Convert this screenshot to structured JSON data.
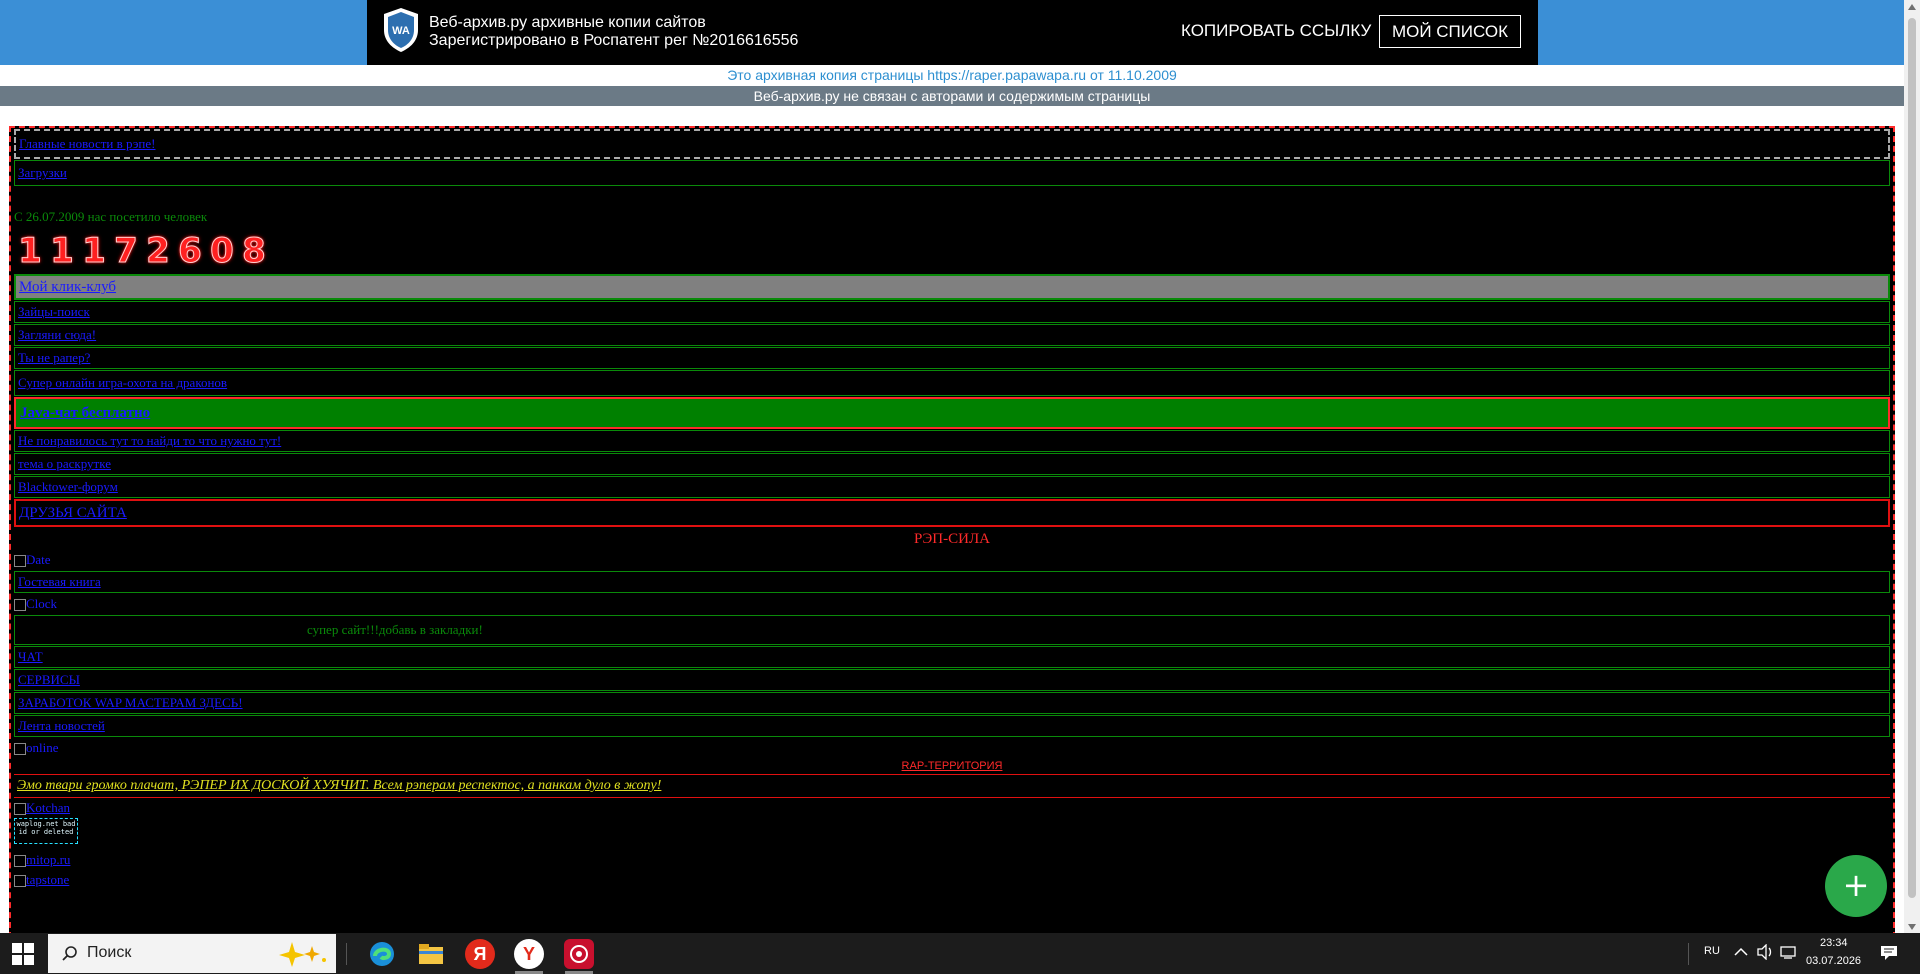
{
  "banner": {
    "brand_line1": "Веб-архив.ру архивные копии сайтов",
    "brand_line2": "Зарегистрировано в Роспатент рег №2016616556",
    "copy_link": "КОПИРОВАТЬ ССЫЛКУ",
    "my_list": "МОЙ СПИСОК",
    "logo_text": "WA",
    "archive_note": "Это архивная копия страницы https://raper.papawapa.ru от 11.10.2009",
    "disclaimer": "Веб-архив.ру не связан с авторами и содержимым страницы"
  },
  "page": {
    "main_news": "Главные новости в рэпе!",
    "downloads": "Загрузки",
    "visits_text": "С 26.07.2009 нас посетило человек",
    "counter_digits": [
      "1",
      "1",
      "1",
      "7",
      "2",
      "6",
      "0",
      "8"
    ],
    "my_click_club": "Мой клик-клуб",
    "links1": [
      "Зайцы-поиск",
      "Загляни сюда!",
      "Ты не рапер?"
    ],
    "game": "Супер онлайн игра-охота на драконов",
    "java_chat": "Java-чат бесплатно",
    "links2": [
      "Не понравилось тут то найди то что нужно тут!",
      "тема о раскрутке",
      "Blacktower-форум"
    ],
    "friends": "ДРУЗЬЯ САЙТА",
    "rap_power": "РЭП-СИЛА",
    "img_date": "Date",
    "guestbook": "Гостевая книга",
    "img_clock": "Clock",
    "super_site": "супер сайт!!!добавь в закладки!",
    "chat": "ЧАТ",
    "services": "СЕРВИСЫ",
    "wap_masters": "ЗАРАБОТОК WAP МАСТЕРАМ ЗДЕСЬ!",
    "news_feed": "Лента новостей",
    "img_online": "online",
    "rap_territory": "RAP-ТЕРРИТОРИЯ",
    "emo_line": "Эмо твари громко плачат, РЭПЕР ИХ ДОСКОЙ ХУЯЧИТ. Всем рэперам респектос, а панкам дуло в жопу!",
    "img_kotchan": "Kotchan",
    "badge_text": "waplog.net bad id or deleted",
    "img_mitop": "mitop.ru",
    "img_tapstone": "tapstone"
  },
  "taskbar": {
    "search_label": "Поиск",
    "lang": "RU",
    "time": "23:34",
    "date": "03.07.2026"
  },
  "colors": {
    "accent_blue": "#3b8fd6",
    "link_blue": "#1a1aff",
    "border_green": "#0a8a0a",
    "alert_red": "#ff2a2a",
    "fab_green": "#2aa84a"
  }
}
